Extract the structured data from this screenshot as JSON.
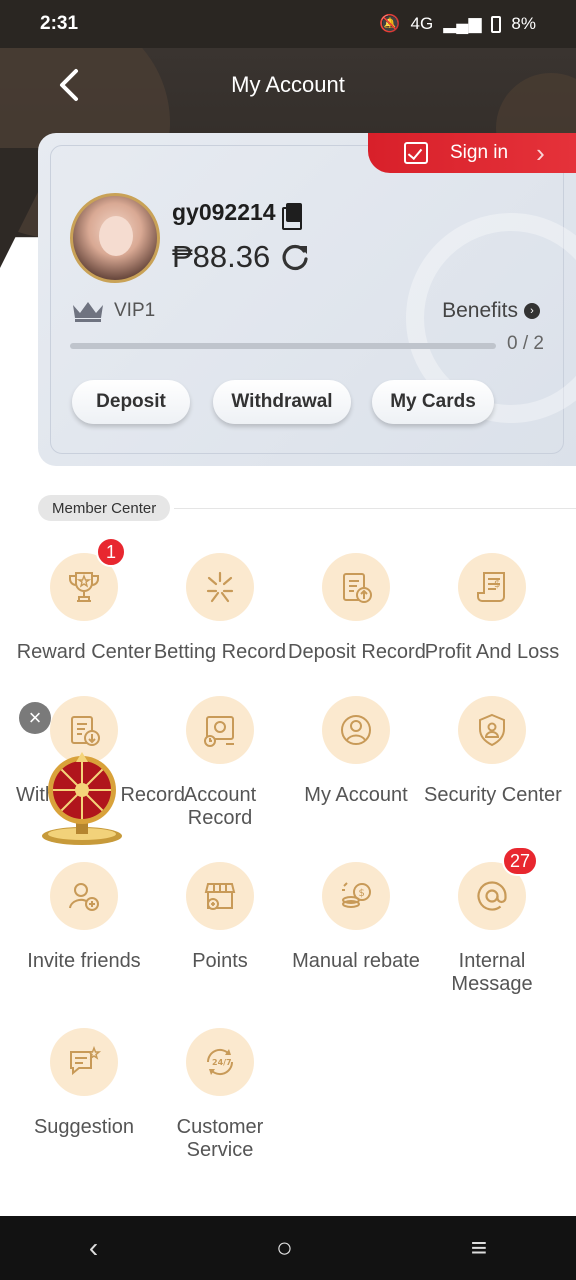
{
  "status_bar": {
    "time": "2:31",
    "network": "4G",
    "battery": "8%"
  },
  "header": {
    "title": "My Account"
  },
  "account_card": {
    "sign_in_label": "Sign in",
    "username": "gy092214",
    "balance": "₱88.36",
    "vip_level": "VIP1",
    "benefits_label": "Benefits",
    "progress_text": "0 / 2",
    "progress_fraction": 0,
    "buttons": {
      "deposit": "Deposit",
      "withdrawal": "Withdrawal",
      "my_cards": "My Cards"
    }
  },
  "member_center": {
    "label": "Member Center",
    "items": [
      {
        "label": "Reward Center",
        "icon": "trophy-icon",
        "badge": "1"
      },
      {
        "label": "Betting Record",
        "icon": "betting-icon"
      },
      {
        "label": "Deposit Record",
        "icon": "deposit-record-icon"
      },
      {
        "label": "Profit And Loss",
        "icon": "profit-loss-icon"
      },
      {
        "label": "Withdrawal Record",
        "icon": "withdrawal-record-icon"
      },
      {
        "label": "Account Record",
        "icon": "account-record-icon"
      },
      {
        "label": "My Account",
        "icon": "user-icon"
      },
      {
        "label": "Security Center",
        "icon": "shield-icon"
      },
      {
        "label": "Invite friends",
        "icon": "invite-icon"
      },
      {
        "label": "Points",
        "icon": "shop-icon"
      },
      {
        "label": "Manual rebate",
        "icon": "coins-icon"
      },
      {
        "label": "Internal Message",
        "icon": "at-icon",
        "badge": "27"
      },
      {
        "label": "Suggestion",
        "icon": "suggestion-icon"
      },
      {
        "label": "Customer Service",
        "icon": "support-24-7-icon"
      }
    ]
  },
  "floating": {
    "close": "×"
  },
  "colors": {
    "accent": "#e8272f",
    "gold": "#c9a257",
    "icon_bg": "#fbe9cf",
    "dark_header": "#2e2925"
  }
}
